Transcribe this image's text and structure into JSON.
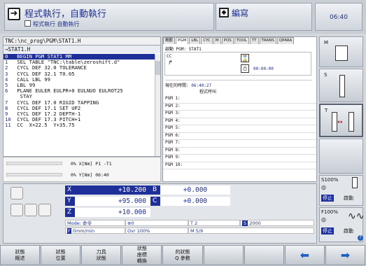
{
  "header": {
    "mode_title": "程式執行，自動執行",
    "mode_sub": "程式執行 自動執行",
    "edit_label": "編寫",
    "clock": "06:40"
  },
  "program": {
    "path": "TNC:\\nc_prog\\PGM\\STAT1.H",
    "file": "→STAT1.H",
    "lines": [
      {
        "n": "0",
        "t": "   BEGIN PGM STAT1 MM"
      },
      {
        "n": "1",
        "t": "   SEL TABLE \"TNC:\\table\\zeroshift.d\""
      },
      {
        "n": "2",
        "t": "   CYCL DEF 32.0 TOLERANCE"
      },
      {
        "n": "3",
        "t": "   CYCL DEF 32.1 T0.05"
      },
      {
        "n": "4",
        "t": "   CALL LBL 99"
      },
      {
        "n": "5",
        "t": "   LBL 99"
      },
      {
        "n": "6",
        "t": "   PLANE EULER EULPR+0 EULNUO EULROT25"
      },
      {
        "n": "",
        "t": "     STAY"
      },
      {
        "n": "7",
        "t": "   CYCL DEF 17.0 RIGID TAPPING"
      },
      {
        "n": "8",
        "t": "   CYCL DEF 17.1 SET UP2"
      },
      {
        "n": "9",
        "t": "   CYCL DEF 17.2 DEPTH-1"
      },
      {
        "n": "10",
        "t": "  CYCL DEF 17.3 PITCH+1"
      },
      {
        "n": "11",
        "t": "  CC  X+22.5  Y+35.75"
      }
    ],
    "progress1": "0% X[Nm] P1  -T1",
    "progress2": "0% Y[Nm] 06:40"
  },
  "status": {
    "tabs": [
      "概觀",
      "PGM",
      "LBL",
      "CYC",
      "M",
      "POS",
      "TOOL",
      "TT",
      "TRANS",
      "QPARA"
    ],
    "active_pgm_label": "啟動 PGM:",
    "active_pgm_value": "STAT1",
    "cc_label": "CC",
    "timer": "00:00:00",
    "current_time_label": "現在的時間:",
    "current_time_value": "06:40:27",
    "call_label": "程式呼叫",
    "pgm_rows": [
      "PGM 1:",
      "PGM 2:",
      "PGM 3:",
      "PGM 4:",
      "PGM 5:",
      "PGM 6:",
      "PGM 7:",
      "PGM 8:",
      "PGM 9:",
      "PGM 10:"
    ]
  },
  "positions": {
    "X": "+10.200",
    "B": "+0.000",
    "Y": "+95.000",
    "C": "+0.000",
    "Z": "+10.000",
    "mode": "Mode: 命令",
    "f_zero": "0",
    "tool": "T 2",
    "s_label": "S",
    "s_value": "2000",
    "feed": "0mm/min",
    "ovr": "Ovr 100%",
    "m": "M 5/9"
  },
  "right_keys": {
    "m_label": "M",
    "s_label": "S",
    "t_label": "T",
    "s100": "S100%",
    "stop1": "停止",
    "start1": "啟動",
    "f100": "F100%",
    "stop2": "停止",
    "start2": "啟動"
  },
  "softkeys": [
    {
      "l1": "狀態",
      "l2": "概述"
    },
    {
      "l1": "狀態",
      "l2": "位置"
    },
    {
      "l1": "刀具",
      "l2": "狀態"
    },
    {
      "l1": "狀態",
      "l2": "座標",
      "l3": "轉換"
    },
    {
      "l1": "的狀態",
      "l2": "Q 參數"
    }
  ]
}
